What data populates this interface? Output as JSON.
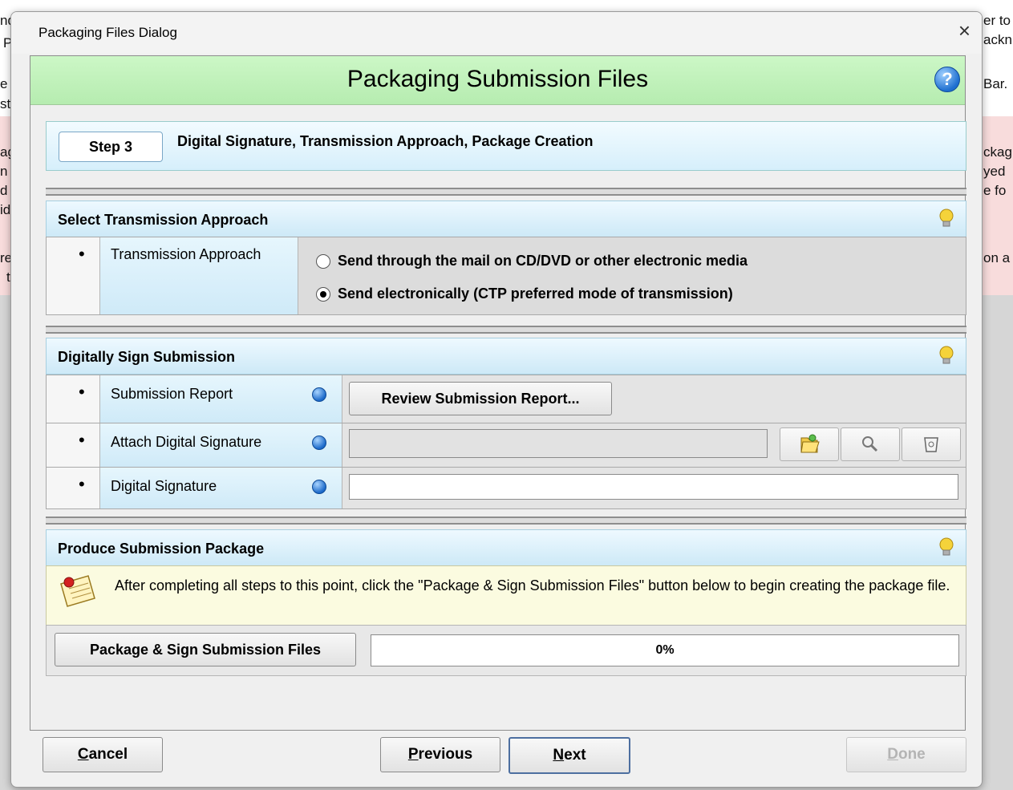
{
  "background": {
    "left_fragments": [
      "nd",
      "P",
      "e a",
      "stir",
      "age",
      "n fi",
      "d a",
      "ide",
      "re",
      "typ"
    ],
    "right_fragments": [
      "er to",
      "ackn",
      "Bar.",
      "ckag",
      "yed",
      "e fo",
      "on a"
    ]
  },
  "dialog": {
    "title": "Packaging Files Dialog",
    "close_glyph": "×",
    "header_title": "Packaging Submission Files",
    "help_glyph": "?"
  },
  "step": {
    "button_label": "Step 3",
    "description": "Digital Signature, Transmission Approach, Package Creation"
  },
  "transmission": {
    "section_title": "Select Transmission Approach",
    "label": "Transmission Approach",
    "options": [
      {
        "label": "Send through the mail on CD/DVD or other electronic media",
        "selected": false
      },
      {
        "label": "Send electronically (CTP preferred mode of transmission)",
        "selected": true
      }
    ]
  },
  "sign": {
    "section_title": "Digitally Sign Submission",
    "rows": [
      {
        "label": "Submission Report"
      },
      {
        "label": "Attach Digital Signature"
      },
      {
        "label": "Digital Signature"
      }
    ],
    "review_button": "Review Submission Report...",
    "attach_value": "",
    "signature_value": "",
    "icons": [
      "folder-open-icon",
      "magnifier-icon",
      "clear-icon"
    ]
  },
  "produce": {
    "section_title": "Produce Submission Package",
    "info_text": "After completing all steps to this point, click the \"Package & Sign Submission Files\" button below to begin creating the package file.",
    "package_button": "Package & Sign Submission Files",
    "progress_text": "0%",
    "progress_value": 0
  },
  "footer": {
    "cancel": {
      "mnemonic": "C",
      "rest": "ancel"
    },
    "previous": {
      "mnemonic": "P",
      "rest": "revious"
    },
    "next": {
      "mnemonic": "N",
      "rest": "ext"
    },
    "done": {
      "mnemonic": "D",
      "rest": "one"
    }
  },
  "colors": {
    "header_green": "#c0f0b8",
    "section_blue": "#d6eefa",
    "info_yellow": "#fbfbe0",
    "radio_dot": "#1b69c9"
  }
}
